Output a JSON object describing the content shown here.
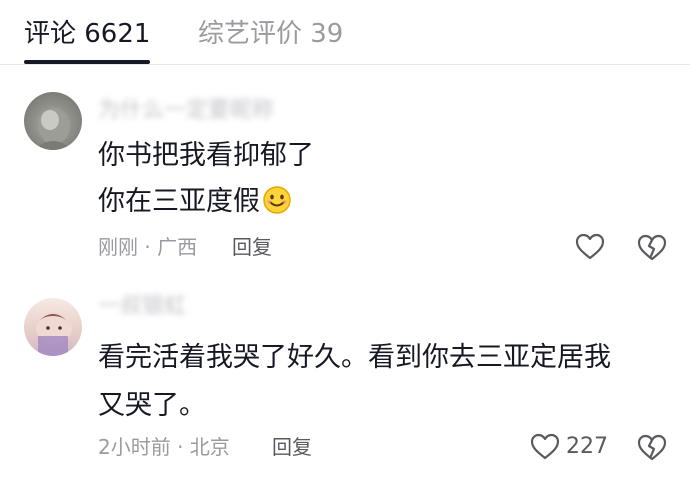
{
  "tabs": {
    "comments": "评论 6621",
    "reviews": "综艺评价 39"
  },
  "comments": [
    {
      "username": "为什么一定要昵称",
      "lines": [
        "你书把我看抑郁了",
        "你在三亚度假"
      ],
      "emoji_icon": "smile-emoji-icon",
      "meta": "刚刚 · 广西",
      "reply": "回复",
      "likes": ""
    },
    {
      "username": "一叔银虹",
      "lines": [
        "看完活着我哭了好久。看到你去三亚定居我",
        "又哭了。"
      ],
      "meta": "2小时前 · 北京",
      "reply": "回复",
      "likes": "227"
    }
  ],
  "colors": {
    "text": "#161823",
    "muted": "#9a9ba0",
    "divider": "#e8e8ea"
  }
}
